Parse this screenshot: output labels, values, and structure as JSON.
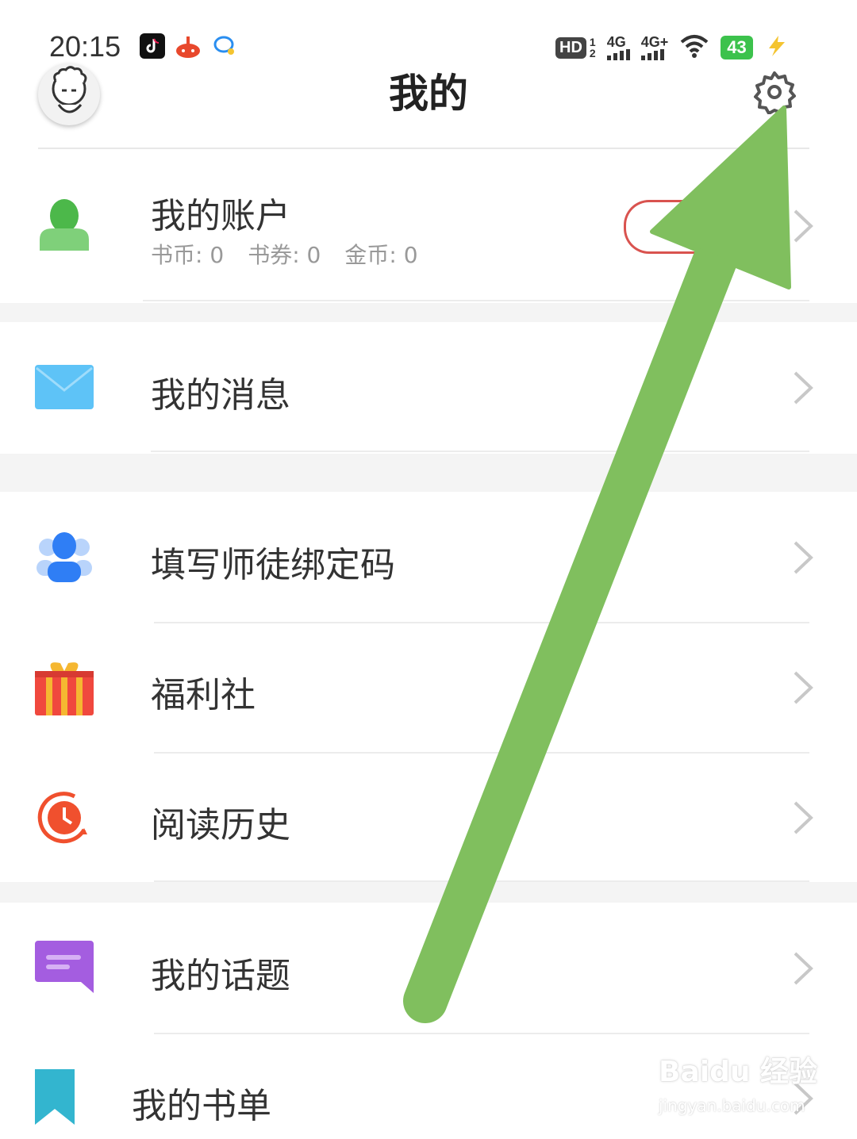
{
  "status_bar": {
    "time": "20:15",
    "hd_label": "HD",
    "sim1": "1",
    "sim2": "2",
    "net1": "4G",
    "net2": "4G+",
    "battery": "43",
    "notification_icons": [
      "tiktok-icon",
      "game-icon",
      "chat-icon"
    ]
  },
  "header": {
    "title": "我的"
  },
  "account": {
    "label": "我的账户",
    "stats": [
      {
        "name": "书币",
        "value": "0"
      },
      {
        "name": "书券",
        "value": "0"
      },
      {
        "name": "金币",
        "value": "0"
      }
    ]
  },
  "menu": {
    "messages": "我的消息",
    "mentor_code": "填写师徒绑定码",
    "welfare": "福利社",
    "history": "阅读历史",
    "topics": "我的话题",
    "booklist": "我的书单"
  },
  "watermark": {
    "brand": "Baidu 经验",
    "url": "jingyan.baidu.com"
  },
  "colors": {
    "arrow": "#80bf5e",
    "account_icon": "#5cc25a",
    "message_icon": "#5ec3f7",
    "mentor_icon": "#2f7ef5",
    "gift_icon": "#f0483e",
    "history_icon": "#f0502e",
    "topic_icon": "#a45de0",
    "booklist_icon": "#33b5cf"
  }
}
